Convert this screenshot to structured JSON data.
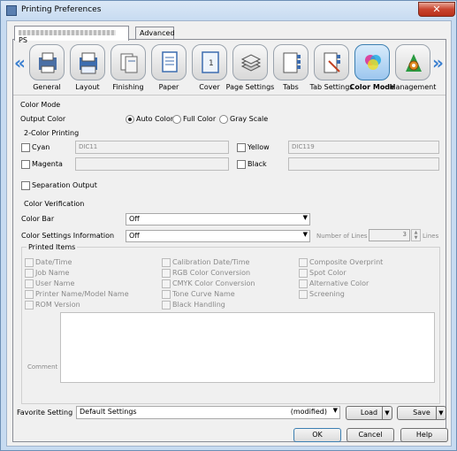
{
  "window": {
    "title": "Printing Preferences",
    "close_label": "✕"
  },
  "tabs": [
    {
      "label": "PS",
      "active": true
    },
    {
      "label": "Advanced",
      "active": false
    }
  ],
  "iconbar": {
    "left_arrow": "«",
    "right_arrow": "»",
    "items": [
      {
        "label": "General",
        "icon": "general-icon"
      },
      {
        "label": "Layout",
        "icon": "layout-icon"
      },
      {
        "label": "Finishing",
        "icon": "finishing-icon"
      },
      {
        "label": "Paper",
        "icon": "paper-icon"
      },
      {
        "label": "Cover",
        "icon": "cover-icon"
      },
      {
        "label": "Page Settings",
        "icon": "page-settings-icon"
      },
      {
        "label": "Tabs",
        "icon": "tabs-icon"
      },
      {
        "label": "Tab Settings",
        "icon": "tab-settings-icon"
      },
      {
        "label": "Color Mode",
        "icon": "color-mode-icon",
        "selected": true
      },
      {
        "label": "Management",
        "icon": "management-icon"
      }
    ],
    "cover_number": "1"
  },
  "color_mode": {
    "section_title": "Color Mode",
    "output_color_label": "Output Color",
    "options": [
      "Auto Color",
      "Full Color",
      "Gray Scale"
    ],
    "selected": "Auto Color",
    "two_color_title": "2-Color Printing",
    "cyan_label": "Cyan",
    "cyan_value": "DIC11",
    "yellow_label": "Yellow",
    "yellow_value": "DIC119",
    "magenta_label": "Magenta",
    "magenta_value": "",
    "black_label": "Black",
    "black_value": "",
    "separation_label": "Separation Output"
  },
  "verification": {
    "section_title": "Color Verification",
    "color_bar_label": "Color Bar",
    "color_bar_value": "Off",
    "settings_info_label": "Color Settings Information",
    "settings_info_value": "Off",
    "number_of_lines_label": "Number of Lines",
    "number_of_lines_value": "3",
    "lines_unit": "Lines",
    "printed_items_title": "Printed Items",
    "items_col1": [
      "Date/Time",
      "Job Name",
      "User Name",
      "Printer Name/Model Name",
      "ROM Version"
    ],
    "items_col2": [
      "Calibration Date/Time",
      "RGB Color Conversion",
      "CMYK Color Conversion",
      "Tone Curve Name",
      "Black Handling"
    ],
    "items_col3": [
      "Composite Overprint",
      "Spot Color",
      "Alternative Color",
      "Screening"
    ],
    "comment_label": "Comment"
  },
  "favorite": {
    "label": "Favorite Setting",
    "value": "Default Settings",
    "modified": "(modified)",
    "load_label": "Load",
    "save_label": "Save"
  },
  "footer": {
    "ok_label": "OK",
    "cancel_label": "Cancel",
    "help_label": "Help"
  }
}
